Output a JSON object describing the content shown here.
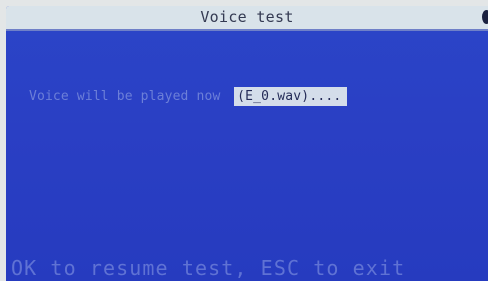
{
  "window": {
    "title": "Voice test"
  },
  "message": {
    "prefix": "Voice will be played now",
    "file": "(E_0.wav)...."
  },
  "status": {
    "text": "OK to resume test, ESC to exit"
  },
  "colors": {
    "screen_background": "#2a3fc4",
    "titlebar": "#d9e3ea",
    "title_text": "#343a52",
    "dim_text": "#6c7fd8",
    "file_chip": "#d4ddea",
    "status_text": "#5f72d4"
  },
  "icons": {
    "corner": "dark-dot-icon"
  }
}
